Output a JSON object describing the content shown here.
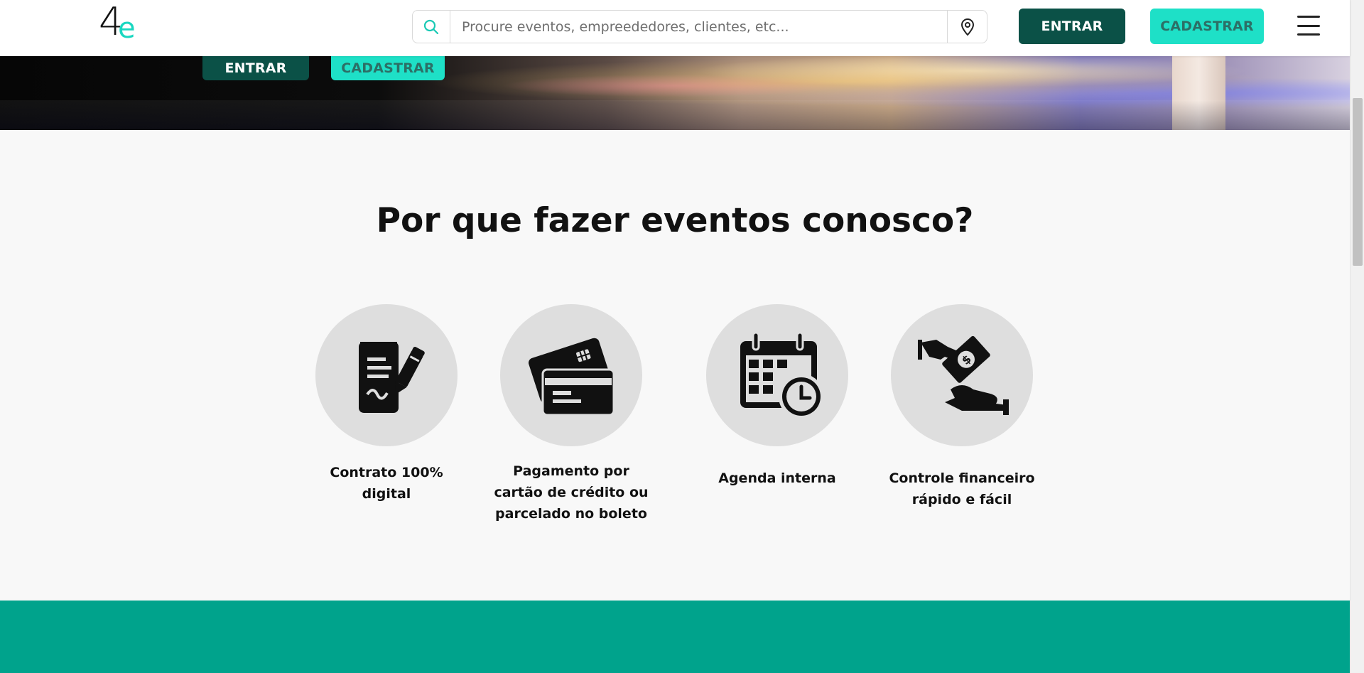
{
  "header": {
    "logo_main": "4",
    "logo_accent": "e",
    "search": {
      "placeholder": "Procure eventos, empreededores, clientes, etc..."
    },
    "entrar_label": "ENTRAR",
    "cadastrar_label": "CADASTRAR"
  },
  "hero": {
    "entrar_label": "ENTRAR",
    "cadastrar_label": "CADASTRAR"
  },
  "section": {
    "title": "Por que fazer eventos conosco?",
    "features": [
      {
        "icon": "contract-icon",
        "label": "Contrato 100% digital"
      },
      {
        "icon": "credit-card-icon",
        "label": "Pagamento por cartão de crédito ou parcelado no boleto"
      },
      {
        "icon": "calendar-clock-icon",
        "label": "Agenda interna"
      },
      {
        "icon": "hand-money-icon",
        "label": "Controle financeiro rápido e fácil"
      }
    ]
  },
  "colors": {
    "brand_dark": "#0b5147",
    "brand_aqua": "#1ee0c7",
    "footer_teal": "#00a38c",
    "icon_circle": "#dedede"
  }
}
